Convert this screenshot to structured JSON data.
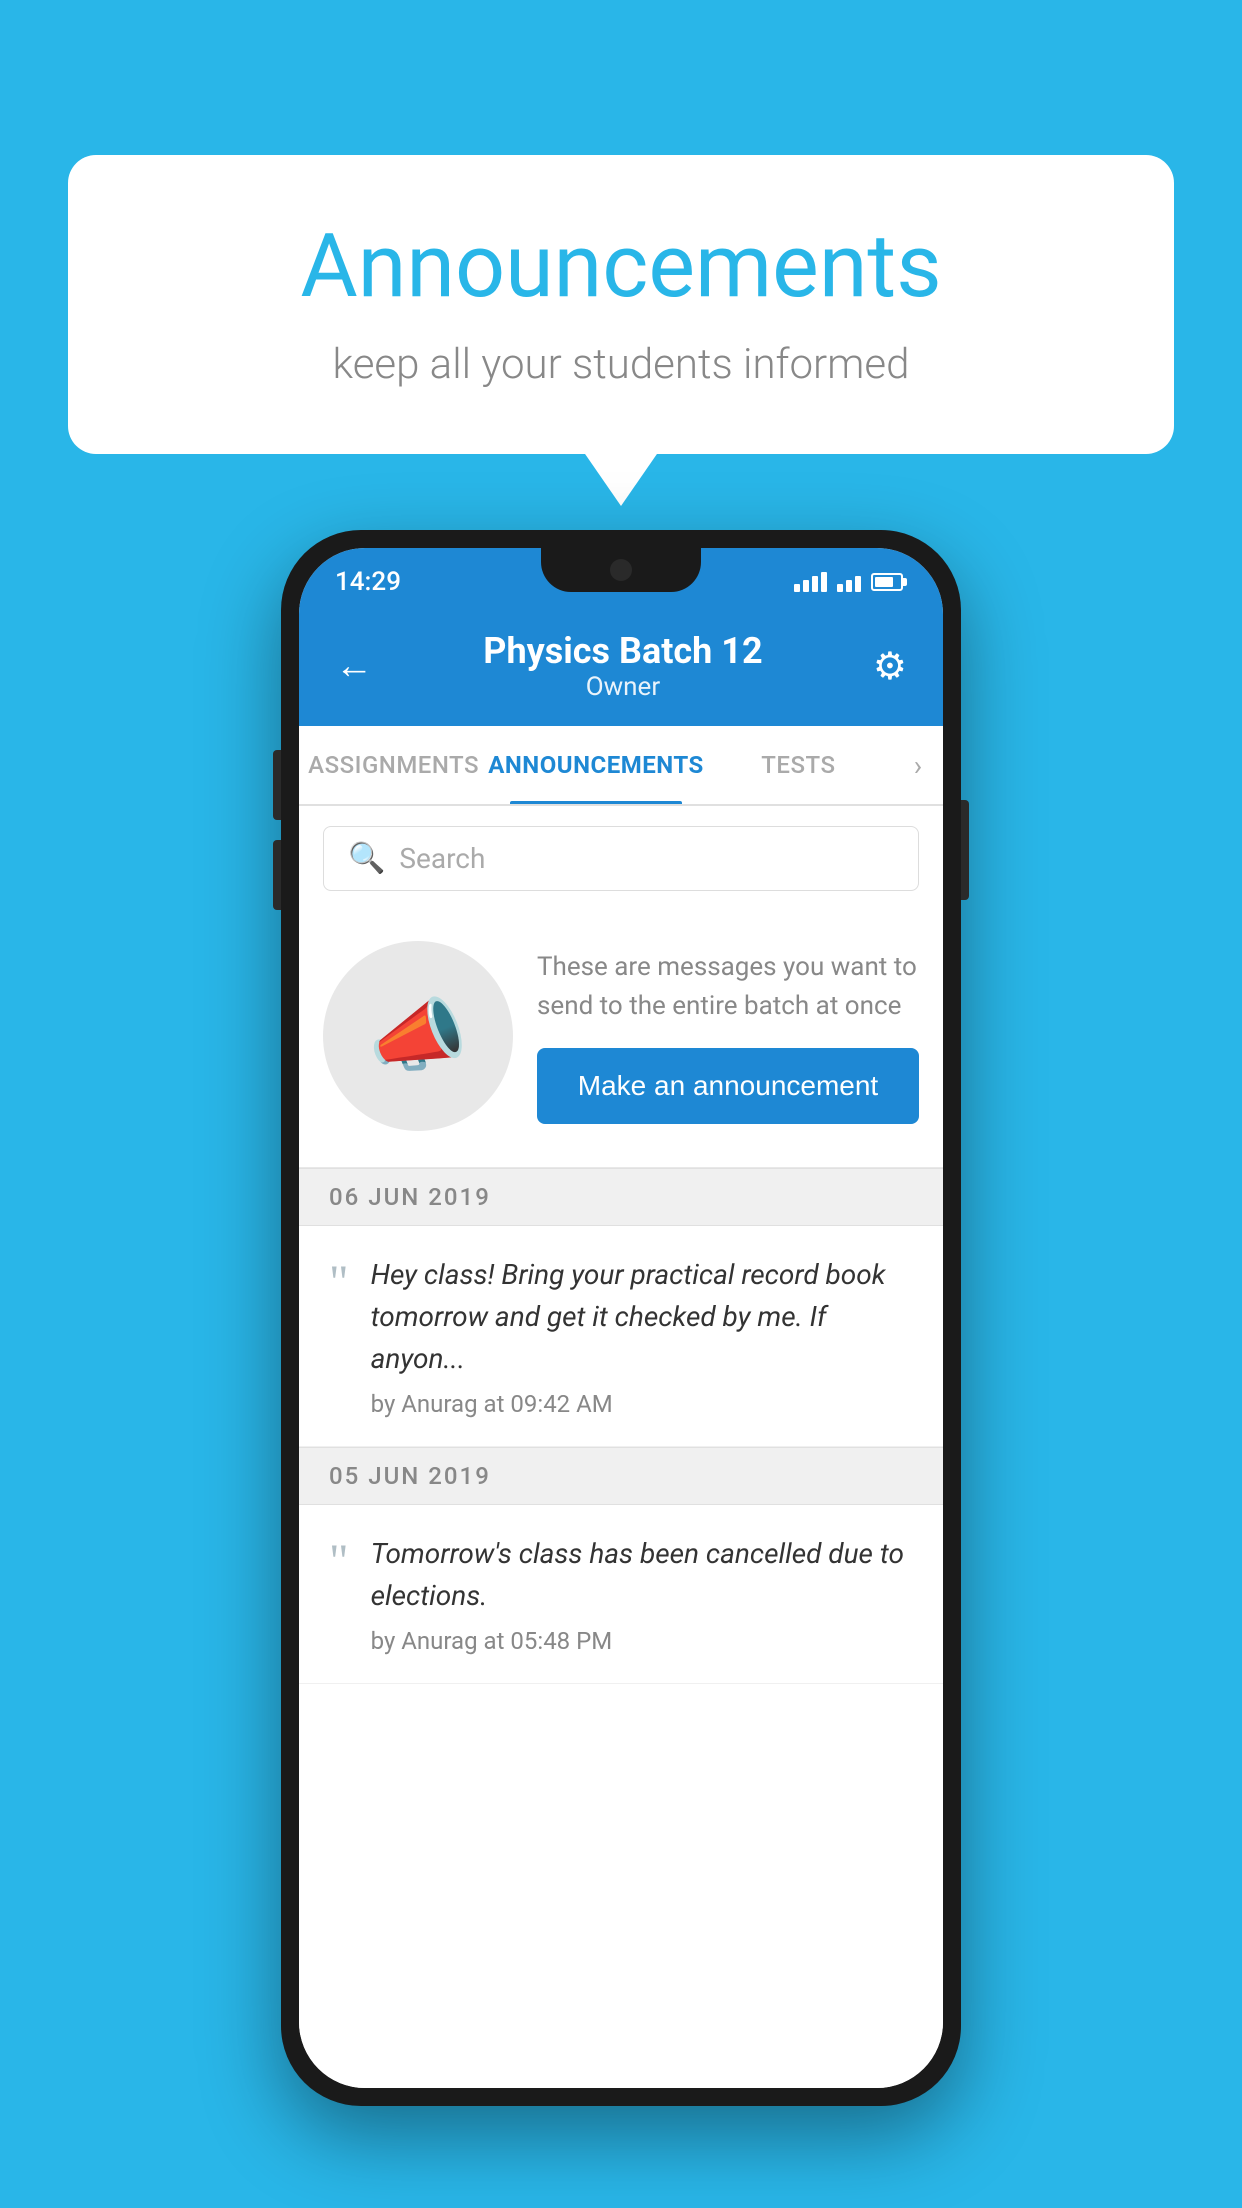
{
  "background_color": "#29B6E8",
  "speech_bubble": {
    "title": "Announcements",
    "subtitle": "keep all your students informed"
  },
  "phone": {
    "status_bar": {
      "time": "14:29"
    },
    "header": {
      "back_label": "←",
      "title": "Physics Batch 12",
      "subtitle": "Owner",
      "gear_label": "⚙"
    },
    "tabs": [
      {
        "label": "ASSIGNMENTS",
        "active": false
      },
      {
        "label": "ANNOUNCEMENTS",
        "active": true
      },
      {
        "label": "TESTS",
        "active": false
      }
    ],
    "search": {
      "placeholder": "Search"
    },
    "promo": {
      "description": "These are messages you want to send to the entire batch at once",
      "button_label": "Make an announcement"
    },
    "date_sections": [
      {
        "date": "06  JUN  2019",
        "announcements": [
          {
            "text": "Hey class! Bring your practical record book tomorrow and get it checked by me. If anyon...",
            "meta": "by Anurag at 09:42 AM"
          }
        ]
      },
      {
        "date": "05  JUN  2019",
        "announcements": [
          {
            "text": "Tomorrow's class has been cancelled due to elections.",
            "meta": "by Anurag at 05:48 PM"
          }
        ]
      }
    ]
  }
}
